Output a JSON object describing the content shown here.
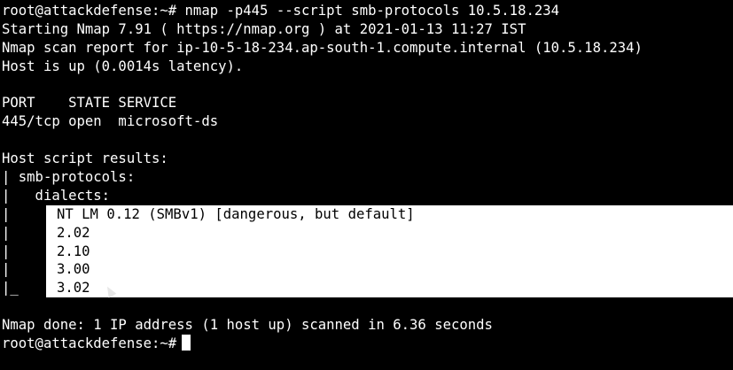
{
  "terminal": {
    "prompt": "root@attackdefense:~#",
    "command": " nmap -p445 --script smb-protocols 10.5.18.234",
    "output": {
      "start": "Starting Nmap 7.91 ( https://nmap.org ) at 2021-01-13 11:27 IST",
      "report": "Nmap scan report for ip-10-5-18-234.ap-south-1.compute.internal (10.5.18.234)",
      "host_up": "Host is up (0.0014s latency).",
      "port_header": "PORT    STATE SERVICE",
      "port_row": "445/tcp open  microsoft-ds",
      "host_script": "Host script results:",
      "smb_protocols": "| smb-protocols:",
      "dialects_label": "|   dialects:",
      "dialect_gutters": [
        "|",
        "|",
        "|",
        "|",
        "|_"
      ],
      "dialects": [
        "NT LM 0.12 (SMBv1) [dangerous, but default]",
        "2.02",
        "2.10",
        "3.00",
        "3.02"
      ],
      "done": "Nmap done: 1 IP address (1 host up) scanned in 6.36 seconds"
    },
    "final_prompt": "root@attackdefense:~#"
  },
  "colors": {
    "background": "#000000",
    "foreground": "#ffffff",
    "selection": "#ffffff",
    "selection_text": "#000000"
  }
}
